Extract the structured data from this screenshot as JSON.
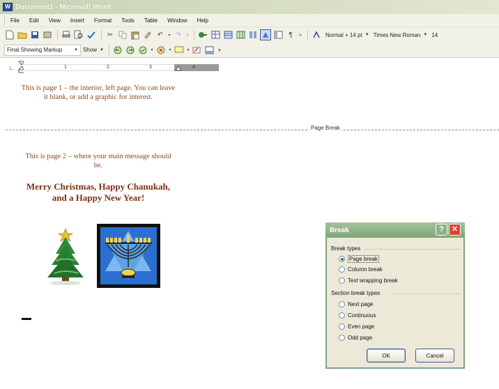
{
  "window": {
    "title": "Document1 - Microsoft Word",
    "app_icon": "W"
  },
  "menu": [
    "File",
    "Edit",
    "View",
    "Insert",
    "Format",
    "Tools",
    "Table",
    "Window",
    "Help"
  ],
  "toolbar_formatting": {
    "style": "Normal + 14 pt",
    "font": "Times New Roman",
    "size": "14"
  },
  "toolbar_review": {
    "markup_view": "Final Showing Markup",
    "show_label": "Show"
  },
  "ruler": {
    "numbers": [
      "1",
      "2",
      "3",
      "4"
    ]
  },
  "document": {
    "page1_text": "This is page 1 – the interior, left page.  You can leave it blank, or add a graphic for interest.",
    "page_break_label": "Page Break",
    "page2_text": "This is page 2 – where your main message should be.",
    "greeting": "Merry Christmas, Happy Chanukah, and a Happy New Year!"
  },
  "dialog": {
    "title": "Break",
    "help_label": "?",
    "break_types_label": "Break types",
    "break_types": [
      "Page break",
      "Column break",
      "Text wrapping break"
    ],
    "section_label": "Section break types",
    "section_types": [
      "Next page",
      "Continuous",
      "Even page",
      "Odd page"
    ],
    "selected": "Page break",
    "ok_label": "OK",
    "cancel_label": "Cancel"
  },
  "colors": {
    "doc_text": "#8b4a1e",
    "greeting": "#7b3011",
    "dialog_title": "#7fa476"
  }
}
